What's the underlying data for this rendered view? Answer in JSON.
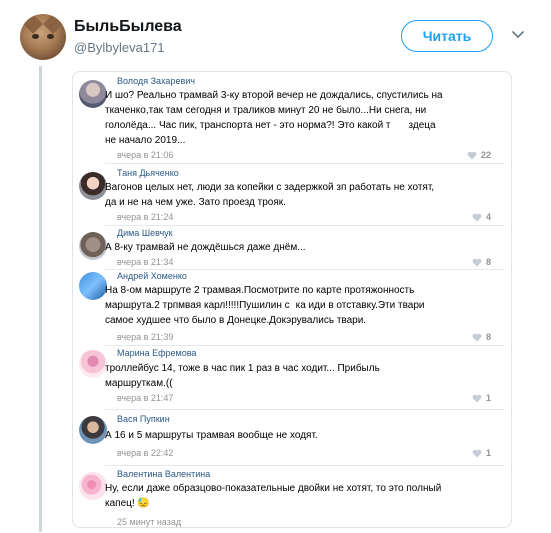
{
  "header": {
    "display_name": "БыльБылева",
    "handle": "@Bylbyleva171",
    "follow_label": "Читать"
  },
  "comments": [
    {
      "author": "Володя Захаревич",
      "text_lines": [
        "И шо? Реально трамвай 3-ку второй вечер не дождались, спустились на",
        "ткаченко,так там сегодня и траликов минут 20 не было...Ни снега, ни",
        "гололёда... Час пик, транспорта нет - это норма?! Это какой т",
        "не начало 2019..."
      ],
      "text_tail": "здеца",
      "date": "вчера в 21:06",
      "likes": "22"
    },
    {
      "author": "Таня Дьяченко",
      "text_lines": [
        "Вагонов целых нет, люди за копейки с задержкой зп работать не хотят,",
        "да и не на чем уже. Зато проезд трояк."
      ],
      "date": "вчера в 21:24",
      "likes": "4"
    },
    {
      "author": "Дима Шевчук",
      "text_lines": [
        "А 8-ку трамвай не дождёшься даже днём..."
      ],
      "date": "вчера в 21:34",
      "likes": "8"
    },
    {
      "author": "Андрей Хоменко",
      "text_lines": [
        "На 8-ом маршруте 2 трамвая.Посмотрите по карте протяжонность",
        "маршрута.2 трпмвая карл!!!!!Пушилин с",
        "самое худшее что было в Донецке.Докэрувались твари."
      ],
      "text_tail": "ка иди в отставку.Эти твари",
      "date": "вчера в 21:39",
      "likes": "8"
    },
    {
      "author": "Марина Ефремова",
      "text_lines": [
        "троллейбус 14, тоже в час пик 1 раз в час ходит... Прибыль",
        "маршруткам.(("
      ],
      "date": "вчера в 21:47",
      "likes": "1"
    },
    {
      "author": "Вася Пупкин",
      "text_lines": [
        "А 16 и 5 маршруты трамвая вообще не ходят."
      ],
      "date": "вчера в 22:42",
      "likes": "1"
    },
    {
      "author": "Валентина Валентина",
      "text_lines": [
        "Ну, если даже образцово-показательные двойки не хотят, то это полный",
        "капец! 😓"
      ],
      "date": "25 минут назад",
      "likes": ""
    }
  ],
  "colors": {
    "accent": "#1da1f2",
    "vk_name": "#2a5885",
    "muted": "#939393"
  }
}
